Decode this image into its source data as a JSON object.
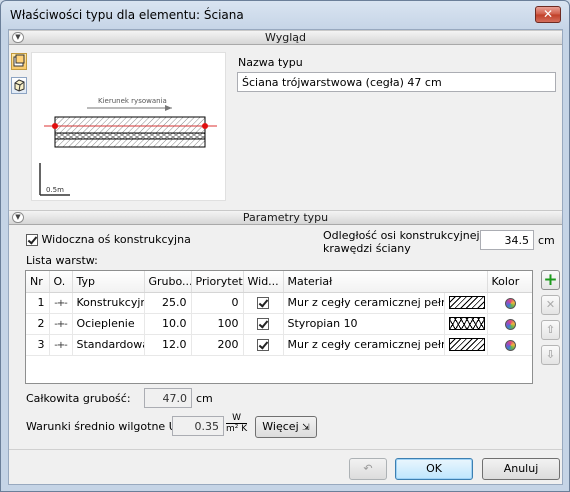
{
  "window": {
    "title": "Właściwości typu dla elementu: Ściana",
    "close_glyph": "✕"
  },
  "sections": {
    "appearance": "Wygląd",
    "params": "Parametry typu"
  },
  "preview": {
    "direction_label": "Kierunek rysowania",
    "scale_label": "0.5m"
  },
  "type_name": {
    "label": "Nazwa typu",
    "value": "Ściana trójwarstwowa (cegła) 47 cm"
  },
  "axis": {
    "visible_label": "Widoczna oś konstrukcyjna",
    "visible_checked": true
  },
  "offset": {
    "label_line1": "Odległość osi konstrukcyjnej od",
    "label_line2": "krawędzi ściany",
    "value": "34.5",
    "unit": "cm"
  },
  "layers": {
    "title": "Lista warstw:",
    "columns": [
      "Nr",
      "O.",
      "Typ",
      "Grubo...",
      "Priorytet",
      "Wid...",
      "Materiał",
      "Kolor"
    ],
    "rows": [
      {
        "nr": "1",
        "type": "Konstrukcyjna",
        "thickness": "25.0",
        "priority": "0",
        "visible": true,
        "material": "Mur z cegły ceramicznej pełnej",
        "hatch": "brick"
      },
      {
        "nr": "2",
        "type": "Ocieplenie",
        "thickness": "10.0",
        "priority": "100",
        "visible": true,
        "material": "Styropian 10",
        "hatch": "styrofoam"
      },
      {
        "nr": "3",
        "type": "Standardowa",
        "thickness": "12.0",
        "priority": "200",
        "visible": true,
        "material": "Mur z cegły ceramicznej pełnej",
        "hatch": "brick"
      }
    ],
    "side_buttons": {
      "add": "+",
      "delete": "✕",
      "up": "⇧",
      "down": "⇩"
    }
  },
  "total": {
    "label": "Całkowita grubość:",
    "value": "47.0",
    "unit": "cm"
  },
  "u_value": {
    "label": "Warunki średnio wilgotne U =",
    "value": "0.35",
    "unit_num": "W",
    "unit_den": "m² K",
    "more_button": "Więcej"
  },
  "footer": {
    "reset_glyph": "↶",
    "ok": "OK",
    "cancel": "Anuluj"
  }
}
